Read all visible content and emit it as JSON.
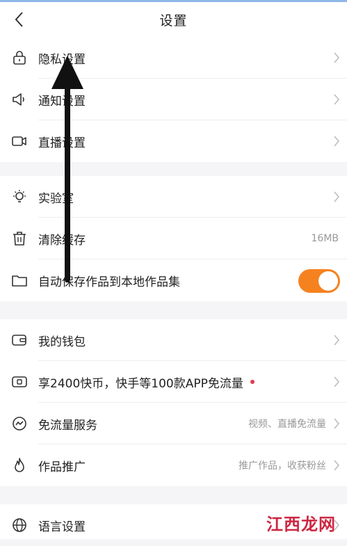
{
  "header": {
    "title": "设置"
  },
  "group1": [
    {
      "icon": "lock-icon",
      "label": "隐私设置"
    },
    {
      "icon": "megaphone-icon",
      "label": "通知设置"
    },
    {
      "icon": "video-camera-icon",
      "label": "直播设置"
    }
  ],
  "group2": [
    {
      "icon": "bulb-icon",
      "label": "实验室"
    },
    {
      "icon": "trash-icon",
      "label": "清除缓存",
      "value": "16MB"
    },
    {
      "icon": "folder-icon",
      "label": "自动保存作品到本地作品集",
      "toggle_on": true
    }
  ],
  "group3": [
    {
      "icon": "wallet-icon",
      "label": "我的钱包"
    },
    {
      "icon": "sim-card-icon",
      "label": "享2400快币，快手等100款APP免流量"
    },
    {
      "icon": "traffic-icon",
      "label": "免流量服务",
      "value": "视频、直播免流量"
    },
    {
      "icon": "flame-icon",
      "label": "作品推广",
      "value": "推广作品，收获粉丝"
    }
  ],
  "group4": [
    {
      "icon": "globe-icon",
      "label": "语言设置"
    }
  ],
  "watermark": "江西龙网",
  "colors": {
    "accent": "#f5821f",
    "dot": "#e23b4e"
  }
}
